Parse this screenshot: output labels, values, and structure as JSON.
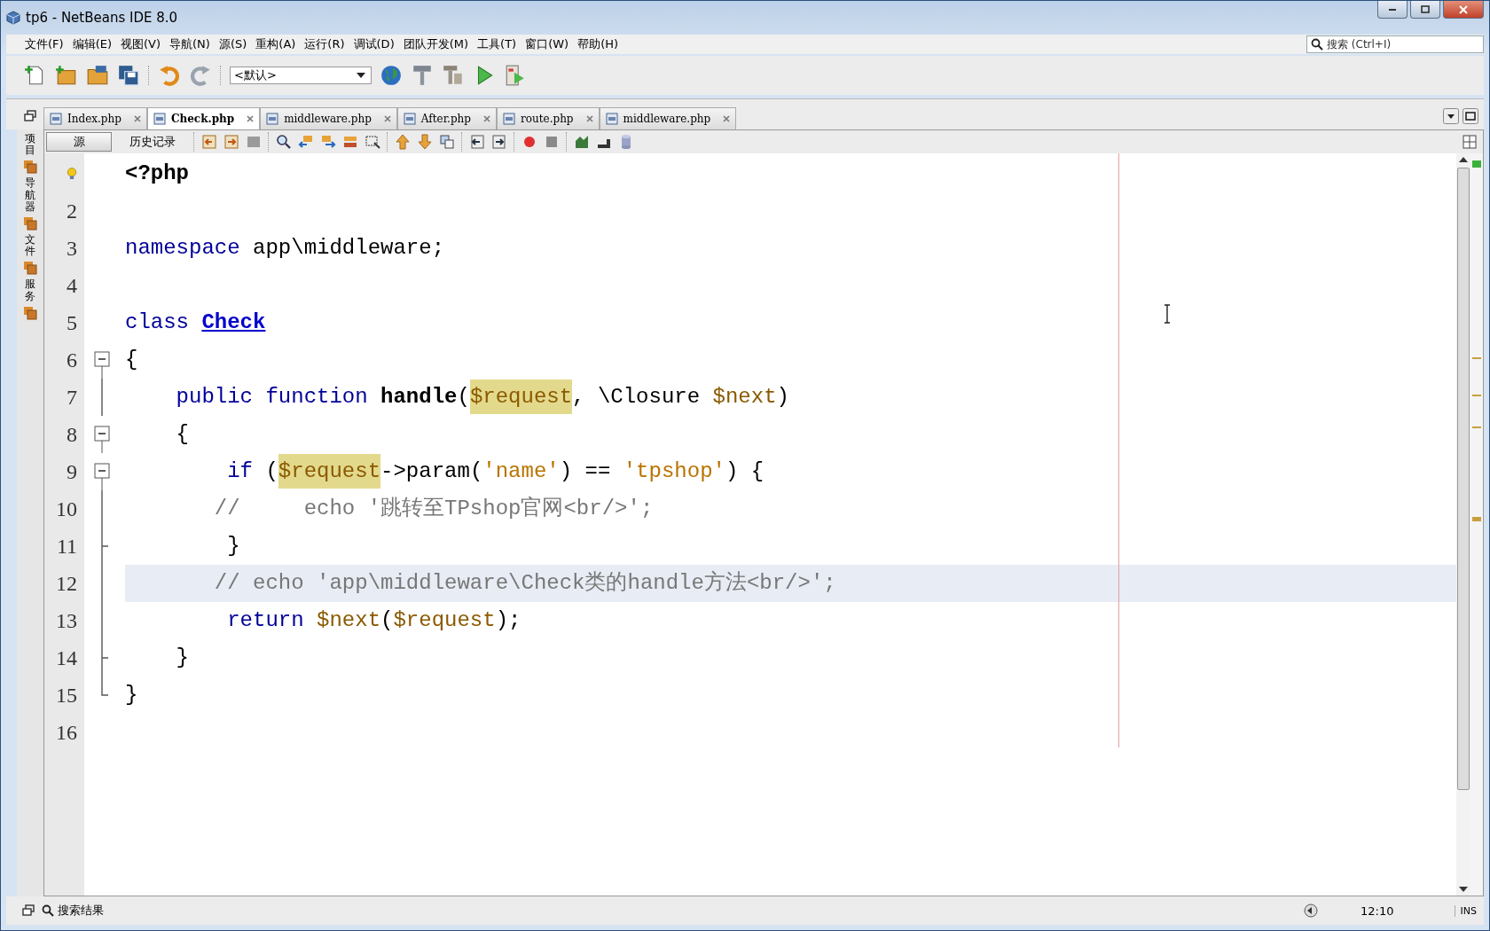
{
  "window": {
    "title": "tp6 - NetBeans IDE 8.0"
  },
  "menu": [
    "文件(F)",
    "编辑(E)",
    "视图(V)",
    "导航(N)",
    "源(S)",
    "重构(A)",
    "运行(R)",
    "调试(D)",
    "团队开发(M)",
    "工具(T)",
    "窗口(W)",
    "帮助(H)"
  ],
  "search": {
    "placeholder": "搜索 (Ctrl+I)"
  },
  "toolbar": {
    "config": "<默认>"
  },
  "side_tabs": [
    {
      "label": "项目"
    },
    {
      "label": "导航器"
    },
    {
      "label": "文件"
    },
    {
      "label": "服务"
    }
  ],
  "tabs": [
    {
      "label": "Index.php",
      "selected": false
    },
    {
      "label": "Check.php",
      "selected": true
    },
    {
      "label": "middleware.php",
      "selected": false
    },
    {
      "label": "After.php",
      "selected": false
    },
    {
      "label": "route.php",
      "selected": false
    },
    {
      "label": "middleware.php",
      "selected": false
    }
  ],
  "editor_modes": [
    {
      "label": "源",
      "selected": true
    },
    {
      "label": "历史记录",
      "selected": false
    }
  ],
  "lines": [
    {
      "hint": true,
      "current": false,
      "kind": "plain",
      "tokens": [
        {
          "kind": "tag",
          "text": "<?php"
        }
      ]
    },
    {
      "hint": false,
      "number": "2",
      "current": false,
      "kind": "plain"
    },
    {
      "hint": false,
      "number": "3",
      "current": false,
      "kind": "plain",
      "tokens": [
        {
          "kind": "keyword",
          "text": "namespace"
        },
        {
          "kind": "plain",
          "text": " app\\middleware;"
        }
      ]
    },
    {
      "hint": false,
      "number": "4",
      "current": false,
      "kind": "plain"
    },
    {
      "hint": false,
      "number": "5",
      "current": false,
      "kind": "plain",
      "tokens": [
        {
          "kind": "keyword",
          "text": "class"
        },
        {
          "kind": "classname",
          "text": "Check",
          "space": true
        }
      ]
    },
    {
      "hint": false,
      "number": "6",
      "current": false,
      "kind": "start",
      "tokens": [
        {
          "kind": "plain",
          "text": "{"
        }
      ]
    },
    {
      "hint": false,
      "number": "7",
      "current": false,
      "kind": "body",
      "tokens": [
        {
          "kind": "keyword",
          "text": "    public function"
        },
        {
          "kind": "function",
          "text": "handle",
          "space": true
        },
        {
          "kind": "plain",
          "text": "("
        },
        {
          "kind": "variable",
          "text": "$request",
          "highlighted": true
        },
        {
          "kind": "plain",
          "text": ", \\Closure "
        },
        {
          "kind": "variable",
          "text": "$next",
          "highlighted": false
        },
        {
          "kind": "plain",
          "text": ")"
        }
      ]
    },
    {
      "hint": false,
      "number": "8",
      "current": false,
      "kind": "start",
      "tokens": [
        {
          "kind": "plain",
          "text": "    {"
        }
      ]
    },
    {
      "hint": false,
      "number": "9",
      "current": false,
      "kind": "start",
      "tokens": [
        {
          "kind": "keyword",
          "text": "        if"
        },
        {
          "kind": "plain",
          "text": " ("
        },
        {
          "kind": "variable",
          "text": "$request",
          "highlighted": true
        },
        {
          "kind": "plain",
          "text": "->param("
        },
        {
          "kind": "string",
          "text": "'name'"
        },
        {
          "kind": "plain",
          "text": ") == "
        },
        {
          "kind": "string",
          "text": "'tpshop'"
        },
        {
          "kind": "plain",
          "text": ") {"
        }
      ]
    },
    {
      "hint": false,
      "number": "10",
      "current": false,
      "kind": "body",
      "tokens": [
        {
          "kind": "comment",
          "text": "       //     echo '跳转至TPshop官网<br/>';"
        }
      ]
    },
    {
      "hint": false,
      "number": "11",
      "current": false,
      "kind": "end",
      "tokens": [
        {
          "kind": "plain",
          "text": "        }"
        }
      ]
    },
    {
      "hint": false,
      "number": "12",
      "current": true,
      "kind": "body",
      "tokens": [
        {
          "kind": "comment",
          "text": "       // echo 'app\\middleware\\Check类的handle方法<br/>';"
        }
      ]
    },
    {
      "hint": false,
      "number": "13",
      "current": false,
      "kind": "body",
      "tokens": [
        {
          "kind": "keyword",
          "text": "        return"
        },
        {
          "kind": "variable",
          "text": "$next",
          "highlighted": false,
          "space": true
        },
        {
          "kind": "plain",
          "text": "("
        },
        {
          "kind": "variable",
          "text": "$request",
          "highlighted": false
        },
        {
          "kind": "plain",
          "text": ");"
        }
      ]
    },
    {
      "hint": false,
      "number": "14",
      "current": false,
      "kind": "end",
      "tokens": [
        {
          "kind": "plain",
          "text": "    }"
        }
      ]
    },
    {
      "hint": false,
      "number": "15",
      "current": false,
      "kind": "last",
      "tokens": [
        {
          "kind": "plain",
          "text": "}"
        }
      ]
    },
    {
      "hint": false,
      "number": "16",
      "current": false,
      "kind": "plain"
    }
  ],
  "status_bar": {
    "output_tab": "搜索结果",
    "position": "12:10",
    "mode": "INS"
  }
}
